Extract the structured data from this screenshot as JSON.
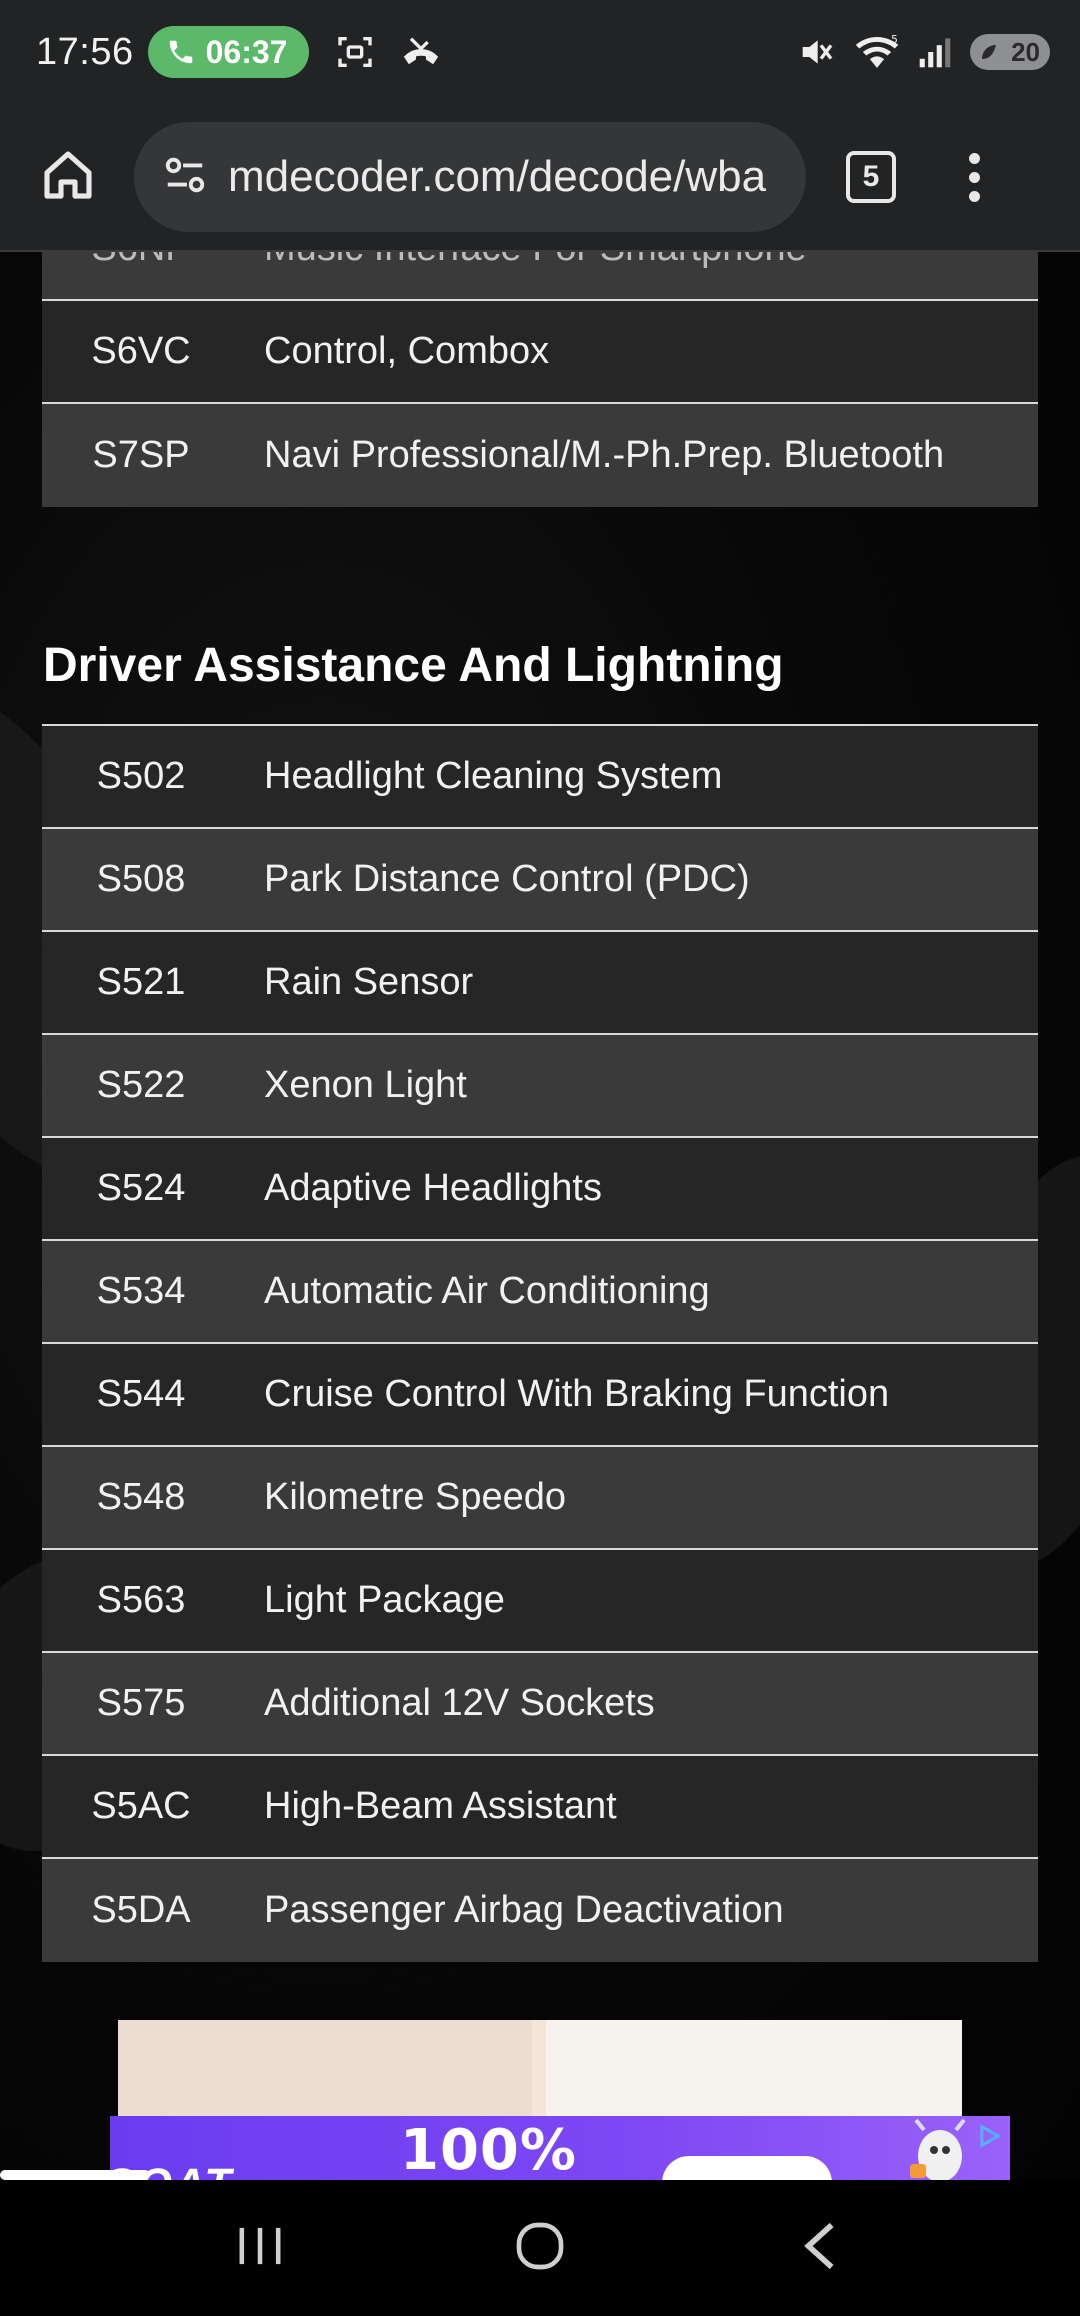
{
  "status_bar": {
    "time": "17:56",
    "call_timer": "06:37",
    "battery": "20",
    "icons": [
      "phone-icon",
      "screenshot-icon",
      "missed-call-icon",
      "mute-icon",
      "wifi-icon",
      "signal-icon",
      "battery-icon"
    ]
  },
  "browser": {
    "url": "mdecoder.com/decode/wba",
    "tab_count": "5"
  },
  "top_rows": [
    {
      "code": "S6VC",
      "desc": "Control, Combox"
    },
    {
      "code": "S7SP",
      "desc": "Navi Professional/M.-Ph.Prep. Bluetooth"
    }
  ],
  "section": {
    "title": "Driver Assistance And Lightning",
    "rows": [
      {
        "code": "S502",
        "desc": "Headlight Cleaning System"
      },
      {
        "code": "S508",
        "desc": "Park Distance Control (PDC)"
      },
      {
        "code": "S521",
        "desc": "Rain Sensor"
      },
      {
        "code": "S522",
        "desc": "Xenon Light"
      },
      {
        "code": "S524",
        "desc": "Adaptive Headlights"
      },
      {
        "code": "S534",
        "desc": "Automatic Air Conditioning"
      },
      {
        "code": "S544",
        "desc": "Cruise Control With Braking Function"
      },
      {
        "code": "S548",
        "desc": "Kilometre Speedo"
      },
      {
        "code": "S563",
        "desc": "Light Package"
      },
      {
        "code": "S575",
        "desc": "Additional 12V Sockets"
      },
      {
        "code": "S5AC",
        "desc": "High-Beam Assistant"
      },
      {
        "code": "S5DA",
        "desc": "Passenger Airbag Deactivation"
      }
    ]
  },
  "ad": {
    "headline": "100%"
  },
  "colors": {
    "call_pill": "#5cb96a",
    "row_dark": "#262626",
    "row_light": "#3a3a3a",
    "ad_purple": "#7f48f5"
  }
}
